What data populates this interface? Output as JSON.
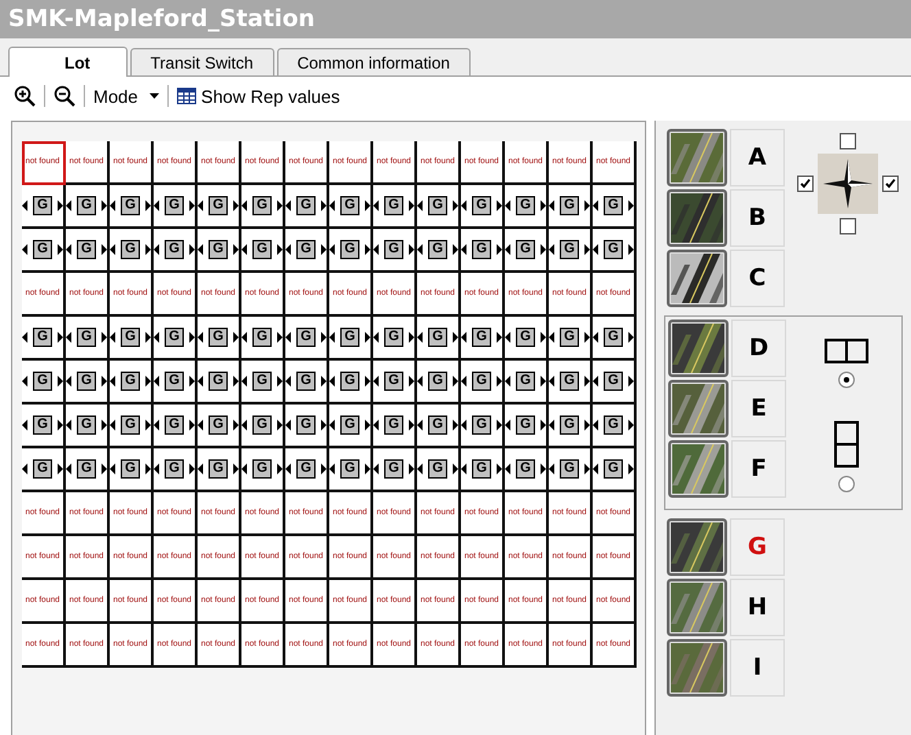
{
  "window": {
    "title": "SMK-Mapleford_Station"
  },
  "tabs": [
    {
      "label": "Lot",
      "selected": true
    },
    {
      "label": "Transit Switch",
      "selected": false
    },
    {
      "label": "Common information",
      "selected": false
    }
  ],
  "toolbar": {
    "mode": "Mode",
    "show_rep": "Show Rep values"
  },
  "grid": {
    "rows": [
      {
        "kind": "missing",
        "cells": [
          {
            "text": "not found",
            "selected": true
          },
          {
            "text": "not found",
            "selected": false
          },
          {
            "text": "not found",
            "selected": false
          },
          {
            "text": "not found",
            "selected": false
          },
          {
            "text": "not found",
            "selected": false
          },
          {
            "text": "not found",
            "selected": false
          },
          {
            "text": "not found",
            "selected": false
          },
          {
            "text": "not found",
            "selected": false
          },
          {
            "text": "not found",
            "selected": false
          },
          {
            "text": "not found",
            "selected": false
          },
          {
            "text": "not found",
            "selected": false
          },
          {
            "text": "not found",
            "selected": false
          },
          {
            "text": "not found",
            "selected": false
          },
          {
            "text": "not found",
            "selected": false
          }
        ]
      },
      {
        "kind": "g",
        "cells": [
          {
            "text": "G",
            "selected": false
          },
          {
            "text": "G",
            "selected": false
          },
          {
            "text": "G",
            "selected": false
          },
          {
            "text": "G",
            "selected": false
          },
          {
            "text": "G",
            "selected": false
          },
          {
            "text": "G",
            "selected": false
          },
          {
            "text": "G",
            "selected": false
          },
          {
            "text": "G",
            "selected": false
          },
          {
            "text": "G",
            "selected": false
          },
          {
            "text": "G",
            "selected": false
          },
          {
            "text": "G",
            "selected": false
          },
          {
            "text": "G",
            "selected": false
          },
          {
            "text": "G",
            "selected": false
          },
          {
            "text": "G",
            "selected": false
          }
        ]
      },
      {
        "kind": "g",
        "cells": [
          {
            "text": "G",
            "selected": false
          },
          {
            "text": "G",
            "selected": false
          },
          {
            "text": "G",
            "selected": false
          },
          {
            "text": "G",
            "selected": false
          },
          {
            "text": "G",
            "selected": false
          },
          {
            "text": "G",
            "selected": false
          },
          {
            "text": "G",
            "selected": false
          },
          {
            "text": "G",
            "selected": false
          },
          {
            "text": "G",
            "selected": false
          },
          {
            "text": "G",
            "selected": false
          },
          {
            "text": "G",
            "selected": false
          },
          {
            "text": "G",
            "selected": false
          },
          {
            "text": "G",
            "selected": false
          },
          {
            "text": "G",
            "selected": false
          }
        ]
      },
      {
        "kind": "missing",
        "cells": [
          {
            "text": "not found",
            "selected": false
          },
          {
            "text": "not found",
            "selected": false
          },
          {
            "text": "not found",
            "selected": false
          },
          {
            "text": "not found",
            "selected": false
          },
          {
            "text": "not found",
            "selected": false
          },
          {
            "text": "not found",
            "selected": false
          },
          {
            "text": "not found",
            "selected": false
          },
          {
            "text": "not found",
            "selected": false
          },
          {
            "text": "not found",
            "selected": false
          },
          {
            "text": "not found",
            "selected": false
          },
          {
            "text": "not found",
            "selected": false
          },
          {
            "text": "not found",
            "selected": false
          },
          {
            "text": "not found",
            "selected": false
          },
          {
            "text": "not found",
            "selected": false
          }
        ]
      },
      {
        "kind": "g",
        "cells": [
          {
            "text": "G",
            "selected": false
          },
          {
            "text": "G",
            "selected": false
          },
          {
            "text": "G",
            "selected": false
          },
          {
            "text": "G",
            "selected": false
          },
          {
            "text": "G",
            "selected": false
          },
          {
            "text": "G",
            "selected": false
          },
          {
            "text": "G",
            "selected": false
          },
          {
            "text": "G",
            "selected": false
          },
          {
            "text": "G",
            "selected": false
          },
          {
            "text": "G",
            "selected": false
          },
          {
            "text": "G",
            "selected": false
          },
          {
            "text": "G",
            "selected": false
          },
          {
            "text": "G",
            "selected": false
          },
          {
            "text": "G",
            "selected": false
          }
        ]
      },
      {
        "kind": "g",
        "cells": [
          {
            "text": "G",
            "selected": false
          },
          {
            "text": "G",
            "selected": false
          },
          {
            "text": "G",
            "selected": false
          },
          {
            "text": "G",
            "selected": false
          },
          {
            "text": "G",
            "selected": false
          },
          {
            "text": "G",
            "selected": false
          },
          {
            "text": "G",
            "selected": false
          },
          {
            "text": "G",
            "selected": false
          },
          {
            "text": "G",
            "selected": false
          },
          {
            "text": "G",
            "selected": false
          },
          {
            "text": "G",
            "selected": false
          },
          {
            "text": "G",
            "selected": false
          },
          {
            "text": "G",
            "selected": false
          },
          {
            "text": "G",
            "selected": false
          }
        ]
      },
      {
        "kind": "g",
        "cells": [
          {
            "text": "G",
            "selected": false
          },
          {
            "text": "G",
            "selected": false
          },
          {
            "text": "G",
            "selected": false
          },
          {
            "text": "G",
            "selected": false
          },
          {
            "text": "G",
            "selected": false
          },
          {
            "text": "G",
            "selected": false
          },
          {
            "text": "G",
            "selected": false
          },
          {
            "text": "G",
            "selected": false
          },
          {
            "text": "G",
            "selected": false
          },
          {
            "text": "G",
            "selected": false
          },
          {
            "text": "G",
            "selected": false
          },
          {
            "text": "G",
            "selected": false
          },
          {
            "text": "G",
            "selected": false
          },
          {
            "text": "G",
            "selected": false
          }
        ]
      },
      {
        "kind": "g",
        "cells": [
          {
            "text": "G",
            "selected": false
          },
          {
            "text": "G",
            "selected": false
          },
          {
            "text": "G",
            "selected": false
          },
          {
            "text": "G",
            "selected": false
          },
          {
            "text": "G",
            "selected": false
          },
          {
            "text": "G",
            "selected": false
          },
          {
            "text": "G",
            "selected": false
          },
          {
            "text": "G",
            "selected": false
          },
          {
            "text": "G",
            "selected": false
          },
          {
            "text": "G",
            "selected": false
          },
          {
            "text": "G",
            "selected": false
          },
          {
            "text": "G",
            "selected": false
          },
          {
            "text": "G",
            "selected": false
          },
          {
            "text": "G",
            "selected": false
          }
        ]
      },
      {
        "kind": "missing",
        "cells": [
          {
            "text": "not found",
            "selected": false
          },
          {
            "text": "not found",
            "selected": false
          },
          {
            "text": "not found",
            "selected": false
          },
          {
            "text": "not found",
            "selected": false
          },
          {
            "text": "not found",
            "selected": false
          },
          {
            "text": "not found",
            "selected": false
          },
          {
            "text": "not found",
            "selected": false
          },
          {
            "text": "not found",
            "selected": false
          },
          {
            "text": "not found",
            "selected": false
          },
          {
            "text": "not found",
            "selected": false
          },
          {
            "text": "not found",
            "selected": false
          },
          {
            "text": "not found",
            "selected": false
          },
          {
            "text": "not found",
            "selected": false
          },
          {
            "text": "not found",
            "selected": false
          }
        ]
      },
      {
        "kind": "missing",
        "cells": [
          {
            "text": "not found",
            "selected": false
          },
          {
            "text": "not found",
            "selected": false
          },
          {
            "text": "not found",
            "selected": false
          },
          {
            "text": "not found",
            "selected": false
          },
          {
            "text": "not found",
            "selected": false
          },
          {
            "text": "not found",
            "selected": false
          },
          {
            "text": "not found",
            "selected": false
          },
          {
            "text": "not found",
            "selected": false
          },
          {
            "text": "not found",
            "selected": false
          },
          {
            "text": "not found",
            "selected": false
          },
          {
            "text": "not found",
            "selected": false
          },
          {
            "text": "not found",
            "selected": false
          },
          {
            "text": "not found",
            "selected": false
          },
          {
            "text": "not found",
            "selected": false
          }
        ]
      },
      {
        "kind": "missing",
        "cells": [
          {
            "text": "not found",
            "selected": false
          },
          {
            "text": "not found",
            "selected": false
          },
          {
            "text": "not found",
            "selected": false
          },
          {
            "text": "not found",
            "selected": false
          },
          {
            "text": "not found",
            "selected": false
          },
          {
            "text": "not found",
            "selected": false
          },
          {
            "text": "not found",
            "selected": false
          },
          {
            "text": "not found",
            "selected": false
          },
          {
            "text": "not found",
            "selected": false
          },
          {
            "text": "not found",
            "selected": false
          },
          {
            "text": "not found",
            "selected": false
          },
          {
            "text": "not found",
            "selected": false
          },
          {
            "text": "not found",
            "selected": false
          },
          {
            "text": "not found",
            "selected": false
          }
        ]
      },
      {
        "kind": "missing",
        "cells": [
          {
            "text": "not found",
            "selected": false
          },
          {
            "text": "not found",
            "selected": false
          },
          {
            "text": "not found",
            "selected": false
          },
          {
            "text": "not found",
            "selected": false
          },
          {
            "text": "not found",
            "selected": false
          },
          {
            "text": "not found",
            "selected": false
          },
          {
            "text": "not found",
            "selected": false
          },
          {
            "text": "not found",
            "selected": false
          },
          {
            "text": "not found",
            "selected": false
          },
          {
            "text": "not found",
            "selected": false
          },
          {
            "text": "not found",
            "selected": false
          },
          {
            "text": "not found",
            "selected": false
          },
          {
            "text": "not found",
            "selected": false
          },
          {
            "text": "not found",
            "selected": false
          }
        ]
      }
    ]
  },
  "tile_groups": [
    {
      "tiles": [
        {
          "label": "A",
          "selected": false
        },
        {
          "label": "B",
          "selected": false
        },
        {
          "label": "C",
          "selected": false
        }
      ],
      "directions": {
        "top": false,
        "left": true,
        "right": true,
        "bottom": false
      }
    },
    {
      "tiles": [
        {
          "label": "D",
          "selected": false
        },
        {
          "label": "E",
          "selected": false
        },
        {
          "label": "F",
          "selected": false
        }
      ],
      "layouts": [
        {
          "kind": "horizontal",
          "selected": true
        },
        {
          "kind": "vertical",
          "selected": false
        }
      ]
    },
    {
      "tiles": [
        {
          "label": "G",
          "selected": true
        },
        {
          "label": "H",
          "selected": false
        },
        {
          "label": "I",
          "selected": false
        }
      ]
    }
  ]
}
